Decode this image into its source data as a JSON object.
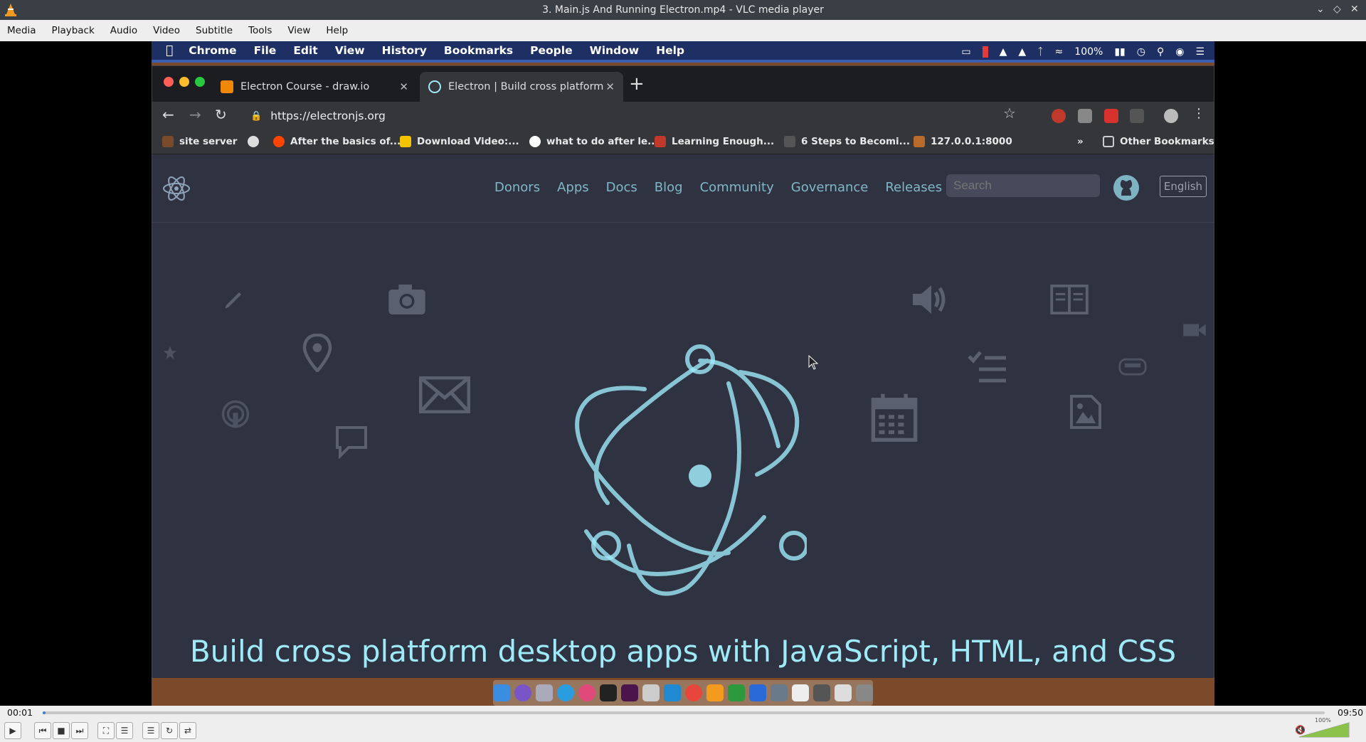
{
  "vlc": {
    "window_title": "3. Main.js And Running Electron.mp4 - VLC media player",
    "menu": [
      "Media",
      "Playback",
      "Audio",
      "Video",
      "Subtitle",
      "Tools",
      "View",
      "Help"
    ],
    "time_elapsed": "00:01",
    "time_total": "09:50",
    "progress_fraction": 0.002,
    "volume_label": "100%",
    "volume_fraction": 1.0
  },
  "mac": {
    "menubar": [
      "Chrome",
      "File",
      "Edit",
      "View",
      "History",
      "Bookmarks",
      "People",
      "Window",
      "Help"
    ],
    "battery": "100%"
  },
  "browser": {
    "tabs": [
      {
        "title": "Electron Course - draw.io",
        "favicon": "drawio-icon"
      },
      {
        "title": "Electron | Build cross platform",
        "favicon": "electron-icon"
      }
    ],
    "url": "https://electronjs.org",
    "bookmarks": [
      "site server",
      "After the basics of...",
      "Download Video:...",
      "what to do after le...",
      "Learning Enough...",
      "6 Steps to Becomi...",
      "127.0.0.1:8000"
    ],
    "other_bookmarks": "Other Bookmarks",
    "overflow": "»"
  },
  "site": {
    "nav": [
      "Donors",
      "Apps",
      "Docs",
      "Blog",
      "Community",
      "Governance",
      "Releases"
    ],
    "search_placeholder": "Search",
    "language": "English",
    "tagline": "Build cross platform desktop apps with JavaScript, HTML, and CSS",
    "accent_color": "#9feaf9",
    "background_color": "#2f3241"
  }
}
